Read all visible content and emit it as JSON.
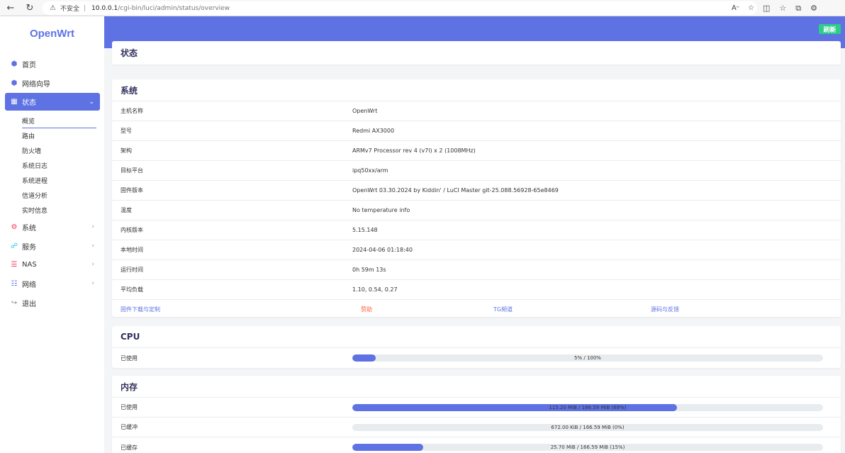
{
  "browser": {
    "insecure_label": "不安全",
    "url_host": "10.0.0.1",
    "url_path": "/cgi-bin/luci/admin/status/overview"
  },
  "sidebar": {
    "logo": "OpenWrt",
    "items": [
      {
        "label": "首页"
      },
      {
        "label": "网络向导"
      },
      {
        "label": "状态"
      },
      {
        "label": "系统"
      },
      {
        "label": "服务"
      },
      {
        "label": "NAS"
      },
      {
        "label": "网络"
      },
      {
        "label": "退出"
      }
    ],
    "status_sub": [
      "概览",
      "路由",
      "防火墙",
      "系统日志",
      "系统进程",
      "信道分析",
      "实时信息"
    ]
  },
  "header": {
    "refresh_label": "刷新",
    "page_title": "状态"
  },
  "system": {
    "title": "系统",
    "rows": [
      {
        "key": "主机名称",
        "value": "OpenWrt"
      },
      {
        "key": "型号",
        "value": "Redmi AX3000"
      },
      {
        "key": "架构",
        "value": "ARMv7 Processor rev 4 (v7l) x 2 (1008MHz)"
      },
      {
        "key": "目标平台",
        "value": "ipq50xx/arm"
      },
      {
        "key": "固件版本",
        "value": "OpenWrt 03.30.2024 by Kiddin' / LuCI Master git-25.088.56928-65e8469"
      },
      {
        "key": "温度",
        "value": "No temperature info"
      },
      {
        "key": "内核版本",
        "value": "5.15.148"
      },
      {
        "key": "本地时间",
        "value": "2024-04-06 01:18:40"
      },
      {
        "key": "运行时间",
        "value": "0h 59m 13s"
      },
      {
        "key": "平均负载",
        "value": "1.10, 0.54, 0.27"
      }
    ],
    "links": [
      "固件下载与定制",
      "赞助",
      "TG频道",
      "源码与反馈"
    ],
    "links_colors": {
      "default": "#5e72e4",
      "highlight": "#fb6340"
    }
  },
  "cpu": {
    "title": "CPU",
    "rows": [
      {
        "key": "已使用",
        "text": "5% / 100%",
        "fraction": 0.05
      }
    ]
  },
  "memory": {
    "title": "内存",
    "rows": [
      {
        "key": "已使用",
        "text": "115.20 MiB / 166.59 MiB (69%)",
        "fraction": 0.69
      },
      {
        "key": "已缓冲",
        "text": "672.00 KiB / 166.59 MiB (0%)",
        "fraction": 0.0
      },
      {
        "key": "已缓存",
        "text": "25.70 MiB / 166.59 MiB (15%)",
        "fraction": 0.15
      }
    ]
  },
  "colors": {
    "accent": "#5e72e4",
    "refresh": "#2dce89"
  }
}
